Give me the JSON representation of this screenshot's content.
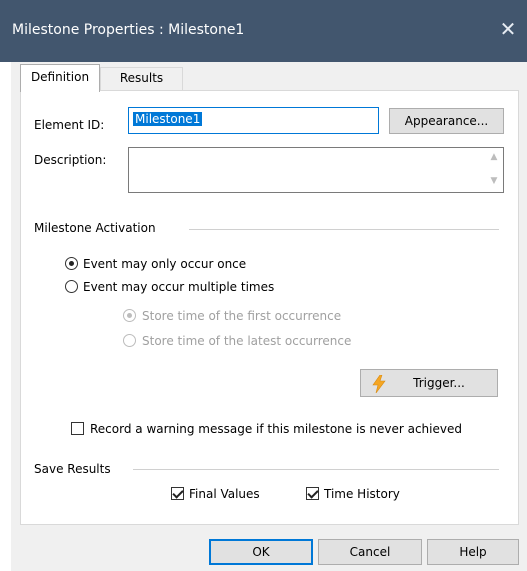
{
  "window": {
    "title": "Milestone Properties : Milestone1",
    "close_glyph": "✕"
  },
  "tabs": [
    {
      "label": "Definition",
      "active": true
    },
    {
      "label": "Results",
      "active": false
    }
  ],
  "definition": {
    "element_id_label": "Element ID:",
    "element_id_value": "Milestone1",
    "appearance_button": "Appearance...",
    "description_label": "Description:",
    "description_value": "",
    "activation_group": "Milestone Activation",
    "radio_once": "Event may only occur once",
    "radio_multiple": "Event may occur multiple times",
    "radio_first": "Store time of the first occurrence",
    "radio_latest": "Store time of the latest occurrence",
    "trigger_button": "Trigger...",
    "warning_checkbox": "Record a warning message if this milestone is never achieved",
    "save_group": "Save Results",
    "final_values": "Final Values",
    "time_history": "Time History"
  },
  "buttons": {
    "ok": "OK",
    "cancel": "Cancel",
    "help": "Help"
  },
  "icons": {
    "close": "close-icon",
    "trigger": "lightning-bolt-icon",
    "scroll_up": "chevron-up-icon",
    "scroll_down": "chevron-down-icon"
  },
  "colors": {
    "titlebar": "#42566e",
    "accent": "#0078d7",
    "bolt": "#f5a623"
  }
}
